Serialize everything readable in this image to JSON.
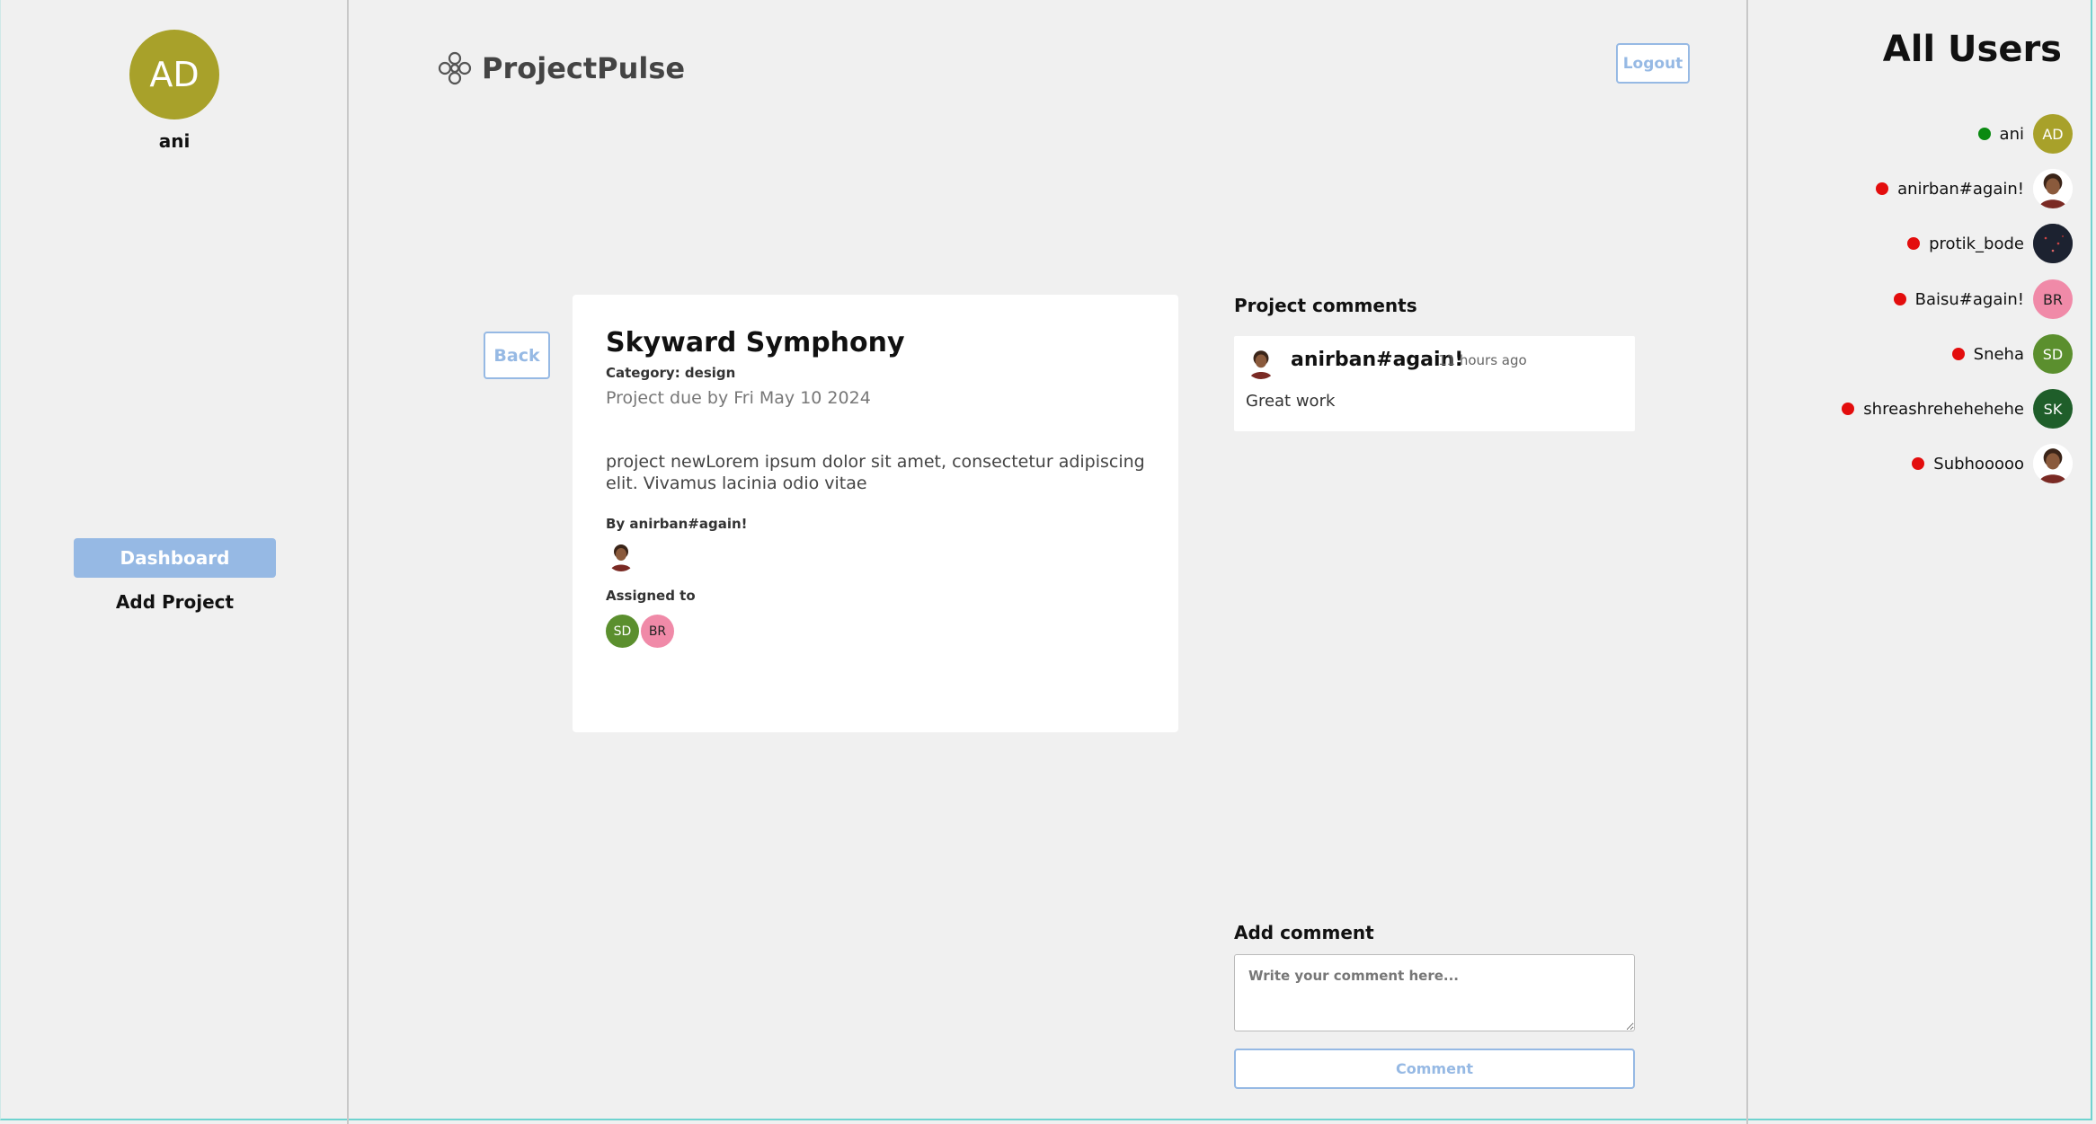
{
  "app": {
    "name": "ProjectPulse"
  },
  "current_user": {
    "initials": "AD",
    "name": "ani",
    "avatar_color": "#a8a12a"
  },
  "sidebar": {
    "items": [
      {
        "label": "Dashboard",
        "active": true
      },
      {
        "label": "Add Project",
        "active": false
      }
    ]
  },
  "header": {
    "logout_label": "Logout"
  },
  "project": {
    "back_label": "Back",
    "title": "Skyward Symphony",
    "category": "Category: design",
    "due": "Project due by Fri May 10 2024",
    "description": "project newLorem ipsum dolor sit amet, consectetur adipiscing elit. Vivamus lacinia odio vitae",
    "by_label": "By anirban#again!",
    "assigned_label": "Assigned to",
    "assignees": [
      {
        "initials": "SD",
        "color": "#5b8f2e",
        "text_color": "#ffffff"
      },
      {
        "initials": "BR",
        "color": "#f08aa8",
        "text_color": "#222222"
      }
    ]
  },
  "comments": {
    "title": "Project comments",
    "items": [
      {
        "author": "anirban#again!",
        "time": "11 hours ago",
        "text": "Great work"
      }
    ],
    "add_title": "Add comment",
    "placeholder": "Write your comment here...",
    "submit_label": "Comment"
  },
  "users": {
    "title": "All Users",
    "list": [
      {
        "name": "ani",
        "online": true,
        "avatar": "initials",
        "initials": "AD",
        "color": "#a8a12a"
      },
      {
        "name": "anirban#again!",
        "online": false,
        "avatar": "photo",
        "initials": "",
        "color": "#ffffff"
      },
      {
        "name": "protik_bode",
        "online": false,
        "avatar": "dark-photo",
        "initials": "",
        "color": "#1c2230"
      },
      {
        "name": "Baisu#again!",
        "online": false,
        "avatar": "initials",
        "initials": "BR",
        "color": "#f08aa8"
      },
      {
        "name": "Sneha",
        "online": false,
        "avatar": "initials",
        "initials": "SD",
        "color": "#5b8f2e"
      },
      {
        "name": "shreashrehehehehe",
        "online": false,
        "avatar": "initials",
        "initials": "SK",
        "color": "#1f5e2a"
      },
      {
        "name": "Subhooooo",
        "online": false,
        "avatar": "photo",
        "initials": "",
        "color": "#ffffff"
      }
    ]
  },
  "colors": {
    "accent": "#96b9e4",
    "online": "#0a8a11",
    "offline": "#e30d0d"
  }
}
